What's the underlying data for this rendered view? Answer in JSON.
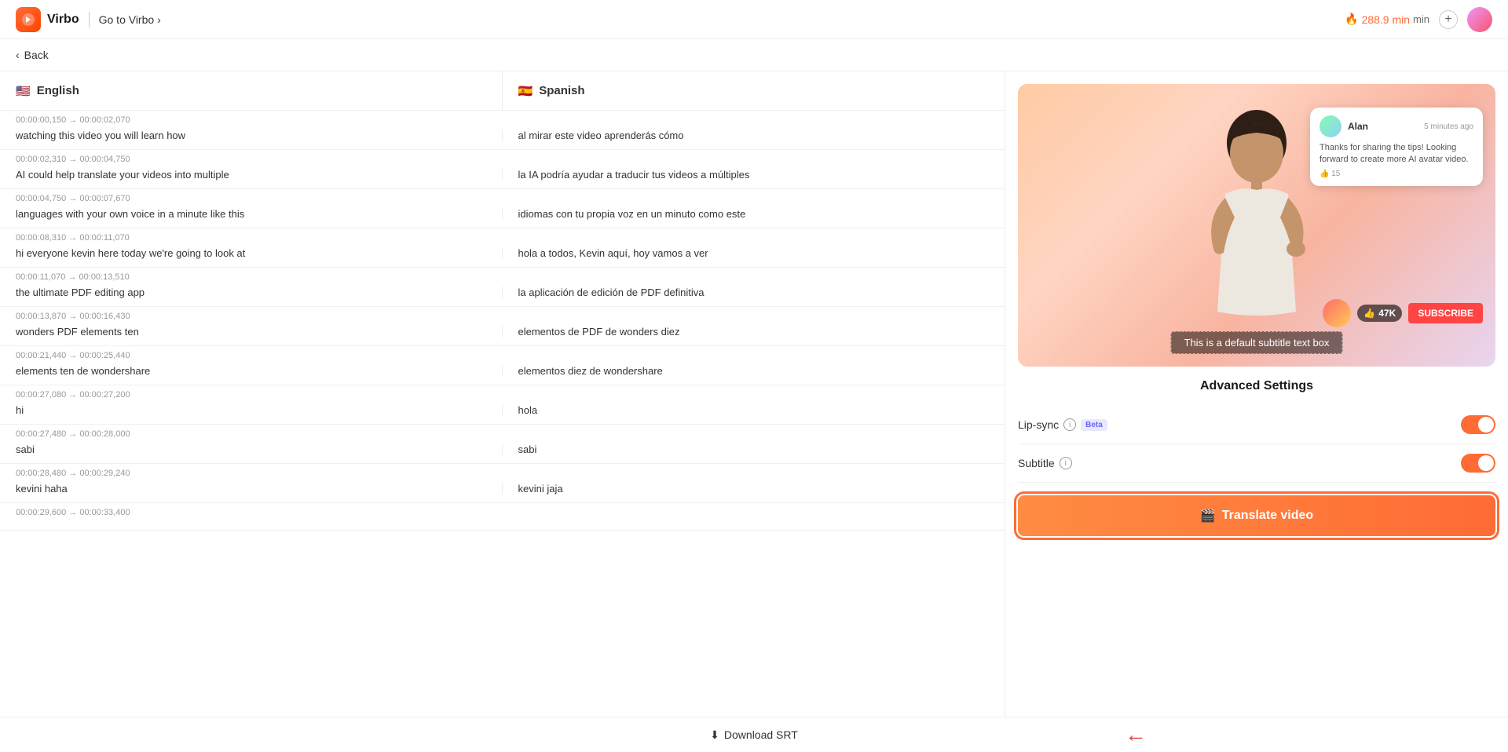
{
  "app": {
    "logo_text": "Virbo",
    "go_to_virbo": "Go to Virbo",
    "chevron": "›",
    "credits": "288.9 min",
    "back_label": "Back"
  },
  "languages": {
    "source": "English",
    "target": "Spanish",
    "source_flag": "🇺🇸",
    "target_flag": "🇪🇸"
  },
  "subtitles": [
    {
      "time": "00:00:00,150 → 00:00:02,070",
      "en": "watching this video you will learn how",
      "es": "al mirar este video aprenderás cómo"
    },
    {
      "time": "00:00:02,310 → 00:00:04,750",
      "en": "AI could help translate your videos into multiple",
      "es": "la IA podría ayudar a traducir tus videos a múltiples"
    },
    {
      "time": "00:00:04,750 → 00:00:07,670",
      "en": "languages with your own voice in a minute like this",
      "es": "idiomas con tu propia voz en un minuto como este"
    },
    {
      "time": "00:00:08,310 → 00:00:11,070",
      "en": "hi everyone kevin here today we're going to look at",
      "es": "hola a todos, Kevin aquí, hoy vamos a ver"
    },
    {
      "time": "00:00:11,070 → 00:00:13,510",
      "en": "the ultimate PDF editing app",
      "es": "la aplicación de edición de PDF definitiva"
    },
    {
      "time": "00:00:13,870 → 00:00:16,430",
      "en": "wonders PDF elements ten",
      "es": "elementos de PDF de wonders diez"
    },
    {
      "time": "00:00:21,440 → 00:00:25,440",
      "en": "elements ten de wondershare",
      "es": "elementos diez de wondershare"
    },
    {
      "time": "00:00:27,080 → 00:00:27,200",
      "en": "hi",
      "es": "hola"
    },
    {
      "time": "00:00:27,480 → 00:00:28,000",
      "en": "sabi",
      "es": "sabi"
    },
    {
      "time": "00:00:28,480 → 00:00:29,240",
      "en": "kevini haha",
      "es": "kevini jaja"
    },
    {
      "time": "00:00:29,600 → 00:00:33,400",
      "en": "",
      "es": ""
    }
  ],
  "video": {
    "comment": {
      "name": "Alan",
      "time": "5 minutes ago",
      "text": "Thanks for sharing the tips! Looking forward to create more AI avatar video.",
      "likes": "15"
    },
    "like_count": "47K",
    "subscribe_label": "SUBSCRIBE",
    "subtitle_text": "This is a default subtitle text box"
  },
  "advanced": {
    "title": "Advanced Settings",
    "lip_sync_label": "Lip-sync",
    "lip_sync_badge": "Beta",
    "subtitle_label": "Subtitle",
    "info_icon": "i"
  },
  "actions": {
    "translate_icon": "▶",
    "translate_label": "Translate video",
    "download_icon": "⬇",
    "download_label": "Download SRT"
  }
}
